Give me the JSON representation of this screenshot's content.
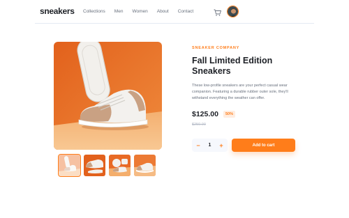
{
  "header": {
    "logo": "sneakers",
    "nav": [
      "Collections",
      "Men",
      "Women",
      "About",
      "Contact"
    ]
  },
  "product": {
    "company": "SNEAKER COMPANY",
    "title": "Fall Limited Edition Sneakers",
    "description": "These low-profile sneakers are your perfect casual wear companion. Featuring a durable rubber outer sole, they'll withstand everything the weather can offer.",
    "price": "$125.00",
    "discount": "50%",
    "old_price": "$250.00",
    "quantity": "1",
    "add_to_cart": "Add to cart",
    "minus": "−",
    "plus": "+"
  },
  "icons": {
    "cart": "cart-icon",
    "avatar": "avatar",
    "minus": "minus-icon",
    "plus": "plus-icon"
  },
  "colors": {
    "accent": "#ff7d1a",
    "accent_pale": "#ffede0",
    "dark": "#1d2026",
    "muted": "#68707d"
  }
}
